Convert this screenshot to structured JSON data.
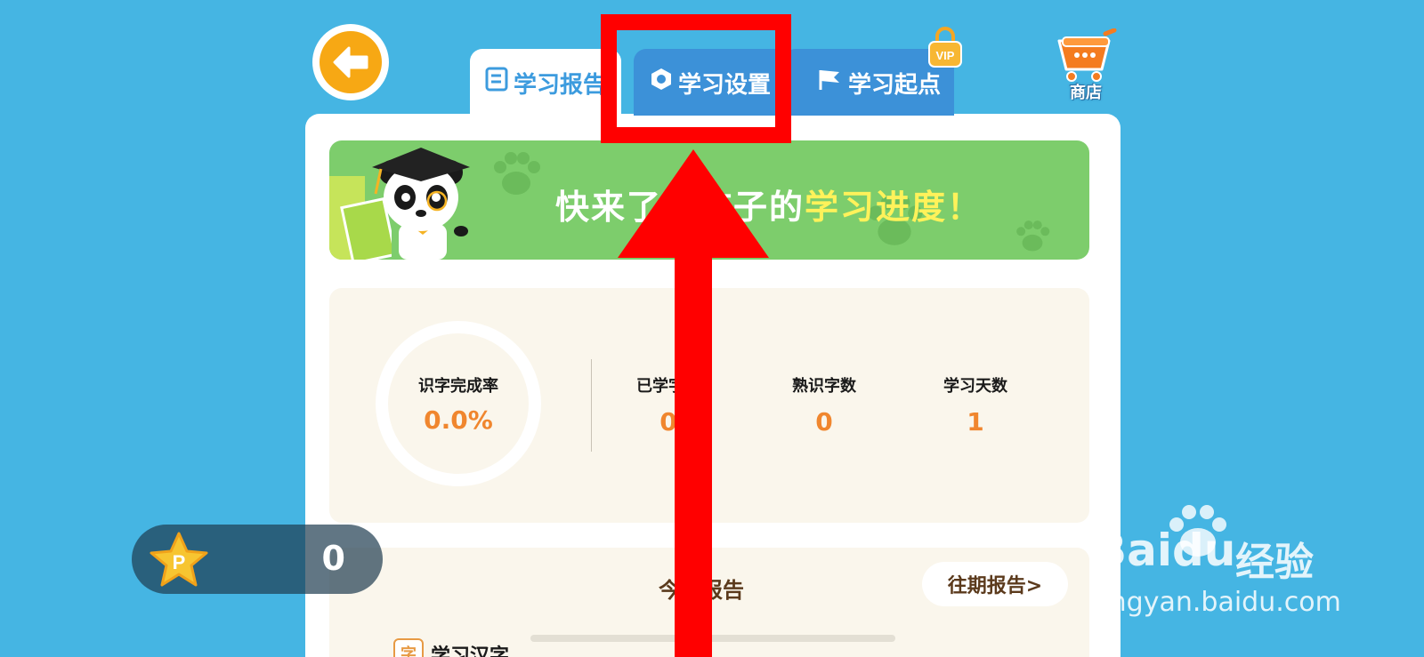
{
  "colors": {
    "background": "#45b5e3",
    "tab_active_text": "#3c9bde",
    "tab_inactive_bg": "#3c91d8",
    "banner_bg": "#7dcd6c",
    "banner_highlight": "#fff25a",
    "stat_value": "#f0862e",
    "annotation": "#ff0000"
  },
  "header": {
    "back_icon": "arrow-left-icon",
    "tabs": [
      {
        "label": "学习报告",
        "icon": "book-icon",
        "active": true
      },
      {
        "label": "学习设置",
        "icon": "hexagon-gear-icon",
        "active": false
      },
      {
        "label": "学习起点",
        "icon": "flag-icon",
        "active": false
      }
    ],
    "vip_badge": "VIP",
    "shop_label": "商店"
  },
  "banner": {
    "text_prefix": "快来了解孩子的",
    "text_highlight": "学习进度！"
  },
  "stats": {
    "completion_label": "识字完成率",
    "completion_value": "0.0%",
    "learned_label": "已学字数",
    "learned_value": "0",
    "familiar_label": "熟识字数",
    "familiar_value": "0",
    "days_label": "学习天数",
    "days_value": "1"
  },
  "coins": {
    "value": "0",
    "icon": "star-coin-icon",
    "coin_letter": "P"
  },
  "report": {
    "title": "今日报告",
    "past_button": "往期报告>",
    "section_icon_char": "字",
    "section_title": "学习汉字"
  },
  "watermark": {
    "brand": "Baidu",
    "brand_suffix": "经验",
    "url": "jingyan.baidu.com"
  }
}
